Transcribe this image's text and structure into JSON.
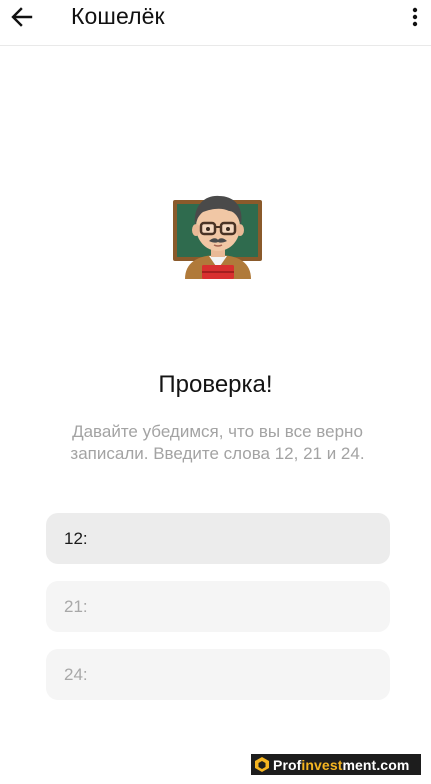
{
  "header": {
    "title": "Кошелёк",
    "back_icon": "arrow-left-icon",
    "menu_icon": "more-vertical-icon"
  },
  "illustration": {
    "icon": "teacher-emoji-icon"
  },
  "main": {
    "heading": "Проверка!",
    "subtitle": "Давайте убедимся, что вы все верно записали. Введите слова 12, 21 и 24."
  },
  "fields": [
    {
      "label": "12:",
      "value": "",
      "active": true
    },
    {
      "label": "21:",
      "value": "",
      "active": false
    },
    {
      "label": "24:",
      "value": "",
      "active": false
    }
  ],
  "watermark": {
    "part1": "Prof",
    "part2": "invest",
    "part3": "ment.com",
    "accent_color": "#f5b521"
  },
  "colors": {
    "background": "#ffffff",
    "field_active": "#ececec",
    "field_inactive": "#f5f5f5",
    "subtitle_text": "#a3a3a3"
  }
}
